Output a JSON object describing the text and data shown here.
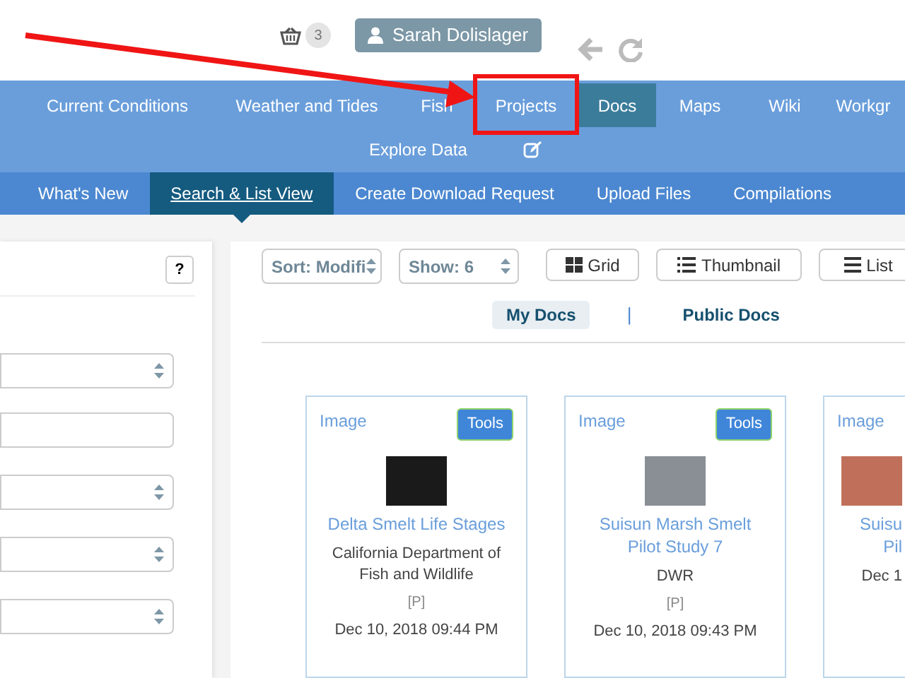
{
  "header": {
    "cart_count": "3",
    "user": "Sarah Dolislager"
  },
  "nav": [
    {
      "label": "Current Conditions",
      "selected": false
    },
    {
      "label": "Weather and Tides",
      "selected": false
    },
    {
      "label": "Fish",
      "selected": false
    },
    {
      "label": "Projects",
      "selected": false
    },
    {
      "label": "Docs",
      "selected": true
    },
    {
      "label": "Maps",
      "selected": false
    },
    {
      "label": "Wiki",
      "selected": false
    },
    {
      "label": "Workgr",
      "selected": false
    }
  ],
  "nav_row2": {
    "label": "Explore Data"
  },
  "subnav": [
    {
      "label": "What's New",
      "selected": false
    },
    {
      "label": "Search & List View",
      "selected": true
    },
    {
      "label": "Create Download Request",
      "selected": false
    },
    {
      "label": "Upload Files",
      "selected": false
    },
    {
      "label": "Compilations",
      "selected": false
    }
  ],
  "sidebar": {
    "help": "?"
  },
  "toolbar": {
    "sort": "Sort: Modifi",
    "show": "Show: 6",
    "views": [
      "Grid",
      "Thumbnail",
      "List"
    ]
  },
  "doc_tabs": [
    {
      "label": "My Docs",
      "selected": true
    },
    {
      "label": "Public Docs",
      "selected": false
    }
  ],
  "doc_tab_separator": "|",
  "cards": [
    {
      "type": "Image",
      "tools": "Tools",
      "title": [
        "Delta Smelt Life Stages"
      ],
      "org": "California Department of Fish and Wildlife",
      "flag": "[P]",
      "date": "Dec 10, 2018 09:44 PM"
    },
    {
      "type": "Image",
      "tools": "Tools",
      "title": [
        "Suisun Marsh Smelt",
        "Pilot Study 7"
      ],
      "org": "DWR",
      "flag": "[P]",
      "date": "Dec 10, 2018 09:43 PM"
    },
    {
      "type": "Image",
      "title": [
        "Suisu",
        "Pil"
      ],
      "date": "Dec 1"
    }
  ]
}
